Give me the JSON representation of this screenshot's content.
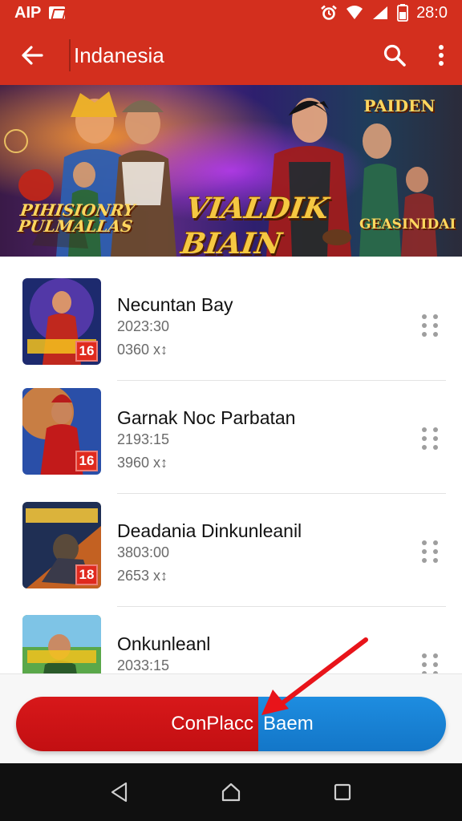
{
  "status_bar": {
    "carrier": "AIP",
    "time": "28:0"
  },
  "app_bar": {
    "title": "Indanesia",
    "back_icon": "arrow-back-icon",
    "search_icon": "search-icon",
    "more_icon": "more-vert-icon"
  },
  "banner": {
    "headline": "VIALDIK\nBIAIN\nCHIOW",
    "logo_left": "PIHISIONRY PULMALLAS",
    "logo_right": "PAIDEN",
    "caption_right": "GEASINIDAI"
  },
  "games": [
    {
      "title": "Necuntan Bay",
      "date": "2023:30",
      "size": "0360 x↕",
      "rating": "16"
    },
    {
      "title": "Garnak Noc Parbatan",
      "date": "2193:15",
      "size": "3960 x↕",
      "rating": "16"
    },
    {
      "title": "Deadania Dinkunleanil",
      "date": "3803:00",
      "size": "2653 x↕",
      "rating": "18"
    },
    {
      "title": "Onkunleanl",
      "date": "2033:15",
      "size": "",
      "rating": ""
    }
  ],
  "cta": {
    "label_left": "ConPlacc",
    "label_right": "Baem"
  },
  "colors": {
    "brand_red": "#d32f1e",
    "cta_red": "#c8111a",
    "cta_blue": "#1a85d6"
  }
}
